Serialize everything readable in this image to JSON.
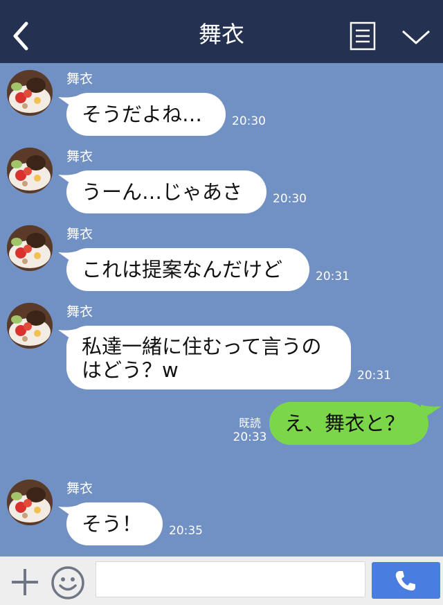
{
  "header": {
    "title": "舞衣",
    "back_icon": "chevron-left-icon",
    "notes_icon": "notes-icon",
    "menu_icon": "chevron-down-icon"
  },
  "messages": [
    {
      "sender": "舞衣",
      "text": "そうだよね…",
      "time": "20:30"
    },
    {
      "sender": "舞衣",
      "text": "うーん…じゃあさ",
      "time": "20:30"
    },
    {
      "sender": "舞衣",
      "text": "これは提案なんだけど",
      "time": "20:31"
    },
    {
      "sender": "舞衣",
      "text_line1": "私達一緒に住むって言うの",
      "text_line2": "はどう？w",
      "time": "20:31"
    },
    {
      "me": true,
      "text": "え、舞衣と？",
      "read": "既読",
      "time": "20:33"
    },
    {
      "sender": "舞衣",
      "text": "そう！",
      "time": "20:35"
    }
  ],
  "footer": {
    "input_value": "",
    "plus_icon": "plus-icon",
    "emoji_icon": "smiley-icon",
    "call_icon": "phone-icon"
  },
  "colors": {
    "header_bg": "#243150",
    "chat_bg": "#7190c3",
    "my_bubble": "#7cd64a",
    "their_bubble": "#ffffff",
    "call_button": "#4a7de0"
  }
}
